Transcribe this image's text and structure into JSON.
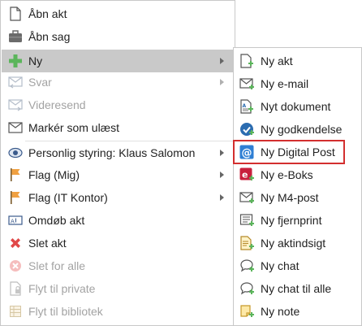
{
  "main_menu": {
    "items": [
      {
        "label": "Åbn akt",
        "icon": "document-icon",
        "disabled": false,
        "submenu": false
      },
      {
        "label": "Åbn sag",
        "icon": "briefcase-icon",
        "disabled": false,
        "submenu": false
      },
      {
        "label": "Ny",
        "icon": "plus-icon",
        "disabled": false,
        "submenu": true,
        "highlighted": true
      },
      {
        "label": "Svar",
        "icon": "reply-mail-icon",
        "disabled": true,
        "submenu": true
      },
      {
        "label": "Videresend",
        "icon": "forward-mail-icon",
        "disabled": true,
        "submenu": false
      },
      {
        "label": "Markér som ulæst",
        "icon": "envelope-icon",
        "disabled": false,
        "submenu": false
      },
      {
        "label": "Personlig styring: Klaus Salomon",
        "icon": "eye-icon",
        "disabled": false,
        "submenu": true
      },
      {
        "label": "Flag (Mig)",
        "icon": "flag-icon",
        "disabled": false,
        "submenu": true
      },
      {
        "label": "Flag (IT Kontor)",
        "icon": "flag-icon",
        "disabled": false,
        "submenu": true
      },
      {
        "label": "Omdøb akt",
        "icon": "rename-icon",
        "disabled": false,
        "submenu": false
      },
      {
        "label": "Slet akt",
        "icon": "delete-x-icon",
        "disabled": false,
        "submenu": false
      },
      {
        "label": "Slet for alle",
        "icon": "delete-circle-icon",
        "disabled": true,
        "submenu": false
      },
      {
        "label": "Flyt til private",
        "icon": "lock-document-icon",
        "disabled": true,
        "submenu": false
      },
      {
        "label": "Flyt til bibliotek",
        "icon": "library-icon",
        "disabled": true,
        "submenu": false
      }
    ]
  },
  "sub_menu": {
    "items": [
      {
        "label": "Ny akt",
        "icon": "new-document-icon"
      },
      {
        "label": "Ny e-mail",
        "icon": "new-mail-icon"
      },
      {
        "label": "Nyt dokument",
        "icon": "new-text-document-icon"
      },
      {
        "label": "Ny godkendelse",
        "icon": "approval-check-icon"
      },
      {
        "label": "Ny Digital Post",
        "icon": "digital-post-at-icon",
        "focused": true
      },
      {
        "label": "Ny e-Boks",
        "icon": "eboks-icon"
      },
      {
        "label": "Ny M4-post",
        "icon": "m4-mail-icon"
      },
      {
        "label": "Ny fjernprint",
        "icon": "remote-print-icon"
      },
      {
        "label": "Ny aktindsigt",
        "icon": "access-request-icon"
      },
      {
        "label": "Ny chat",
        "icon": "chat-icon"
      },
      {
        "label": "Ny chat til alle",
        "icon": "chat-all-icon"
      },
      {
        "label": "Ny note",
        "icon": "note-icon"
      }
    ]
  },
  "colors": {
    "highlight": "#c9c9c9",
    "focus_border": "#d32f2f",
    "disabled_text": "#a3a3a3",
    "green": "#5bb55b",
    "blue": "#2b6cb0",
    "red": "#e04848"
  }
}
